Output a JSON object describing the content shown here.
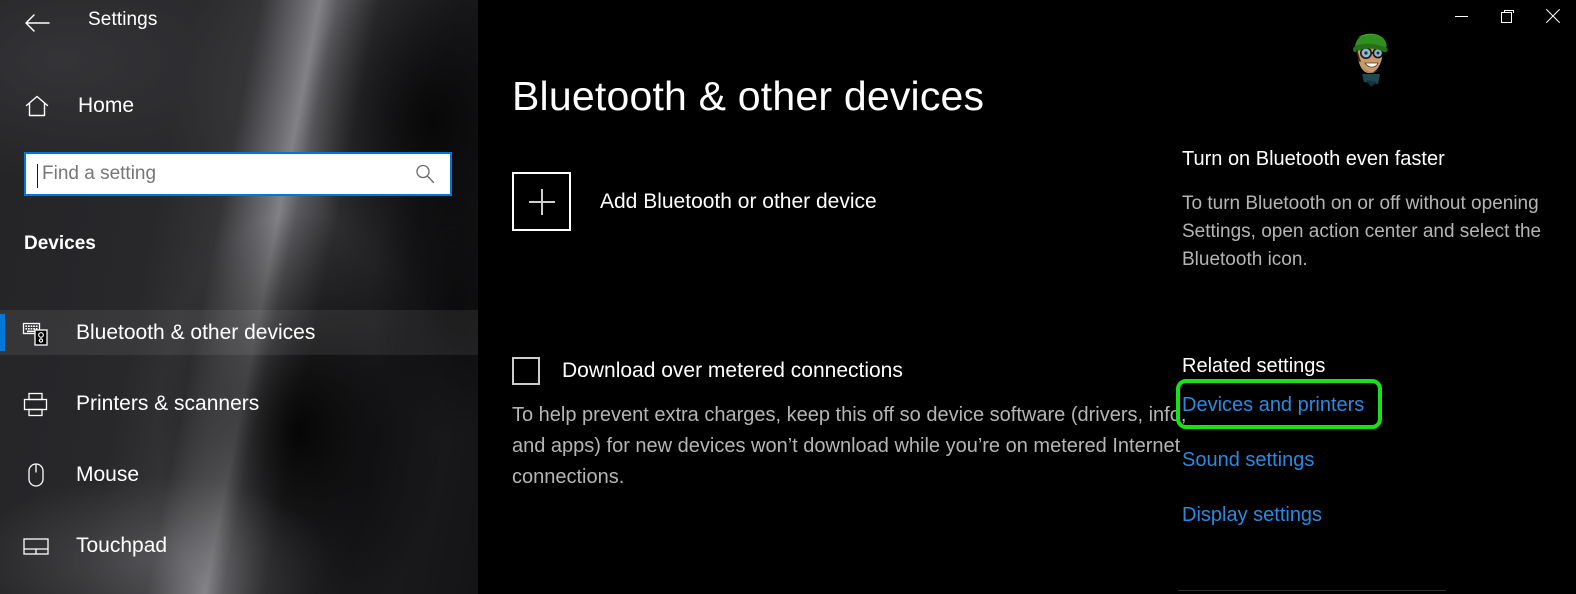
{
  "window": {
    "title": "Settings",
    "back_icon": "back-arrow-icon",
    "minimize_label": "Minimize",
    "restore_label": "Restore",
    "close_label": "Close",
    "avatar_label": "user-avatar"
  },
  "sidebar": {
    "home": {
      "label": "Home",
      "icon": "home-icon"
    },
    "search": {
      "value": "",
      "placeholder": "Find a setting",
      "icon": "search-icon"
    },
    "group_header": "Devices",
    "items": [
      {
        "label": "Bluetooth & other devices",
        "icon": "devices-icon",
        "selected": true
      },
      {
        "label": "Printers & scanners",
        "icon": "printer-icon",
        "selected": false
      },
      {
        "label": "Mouse",
        "icon": "mouse-icon",
        "selected": false
      },
      {
        "label": "Touchpad",
        "icon": "touchpad-icon",
        "selected": false
      }
    ],
    "accent_color": "#0078d7"
  },
  "main": {
    "page_title": "Bluetooth & other devices",
    "add_device": {
      "label": "Add Bluetooth or other device",
      "icon": "plus-square-icon"
    },
    "metered": {
      "label": "Download over metered connections",
      "checked": false,
      "description": "To help prevent extra charges, keep this off so device software (drivers, info, and apps) for new devices won’t download while you’re on metered Internet connections."
    }
  },
  "right_panel": {
    "tip_heading": "Turn on Bluetooth even faster",
    "tip_description": "To turn Bluetooth on or off without opening Settings, open action center and select the Bluetooth icon.",
    "related_heading": "Related settings",
    "links": [
      {
        "label": "Devices and printers",
        "highlighted": true
      },
      {
        "label": "Sound settings",
        "highlighted": false
      },
      {
        "label": "Display settings",
        "highlighted": false
      }
    ],
    "link_color": "#2a8ae0",
    "highlight_color": "#19e119"
  }
}
